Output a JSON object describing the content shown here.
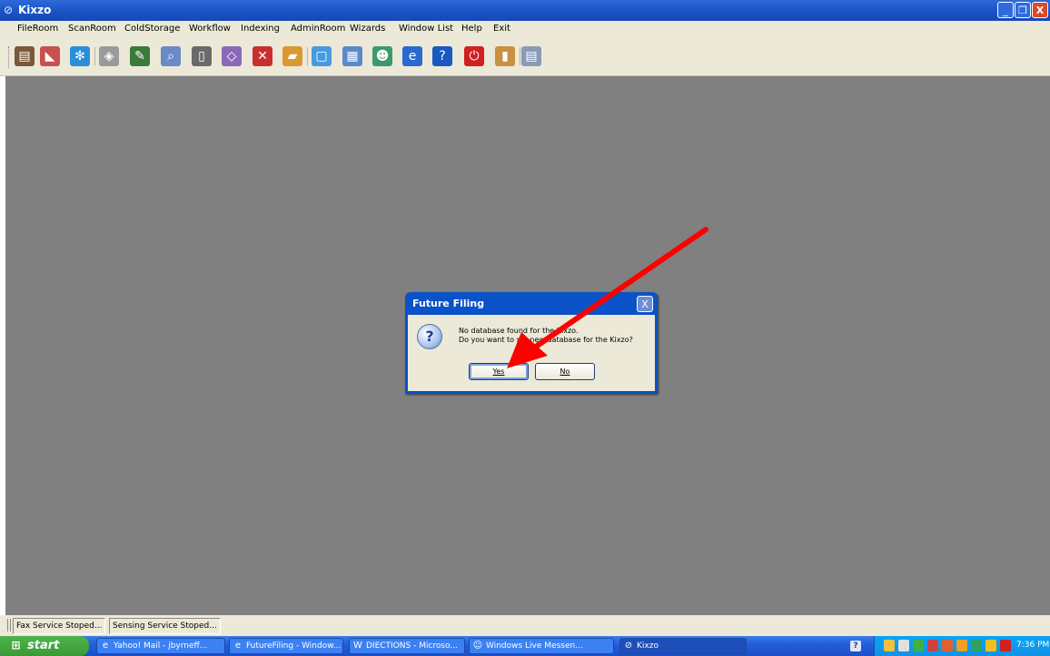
{
  "window": {
    "title": "Kixzo",
    "min": "_",
    "max": "❐",
    "close": "X"
  },
  "menu": {
    "items": [
      "FileRoom",
      "ScanRoom",
      "ColdStorage",
      "Workflow",
      "Indexing",
      "AdminRoom",
      "Wizards",
      "Window List",
      "Help",
      "Exit"
    ]
  },
  "toolbar": {
    "icons": [
      {
        "name": "fileroom-icon",
        "color": "#7a5a3a",
        "glyph": "▤"
      },
      {
        "name": "scanroom-icon",
        "color": "#c85050",
        "glyph": "◣"
      },
      {
        "name": "coldstorage-icon",
        "color": "#2a8ed8",
        "glyph": "✻"
      },
      {
        "name": "workflow-icon",
        "color": "#9a9a9a",
        "glyph": "◈"
      },
      {
        "name": "indexing-icon",
        "color": "#3a7a3a",
        "glyph": "✎"
      },
      {
        "name": "search-doc-icon",
        "color": "#6a8ac8",
        "glyph": "⌕"
      },
      {
        "name": "document-icon",
        "color": "#6a6a6a",
        "glyph": "▯"
      },
      {
        "name": "tag-icon",
        "color": "#8a6ab8",
        "glyph": "◇"
      },
      {
        "name": "delete-icon",
        "color": "#c83030",
        "glyph": "✕"
      },
      {
        "name": "folder-icon",
        "color": "#d89a30",
        "glyph": "▰"
      },
      {
        "name": "pages-icon",
        "color": "#4a9ae0",
        "glyph": "▢"
      },
      {
        "name": "calendar-icon",
        "color": "#5a8ac8",
        "glyph": "▦"
      },
      {
        "name": "users-icon",
        "color": "#3a9a6a",
        "glyph": "☻"
      },
      {
        "name": "internet-explorer-icon",
        "color": "#2a6ad0",
        "glyph": "e"
      },
      {
        "name": "help-icon",
        "color": "#1a5ac0",
        "glyph": "?"
      },
      {
        "name": "power-icon",
        "color": "#d02020",
        "glyph": "⏻"
      },
      {
        "name": "exit-door-icon",
        "color": "#c89040",
        "glyph": "▮"
      },
      {
        "name": "options-dropdown-icon",
        "color": "#8a9ab8",
        "glyph": "▤"
      }
    ]
  },
  "dialog": {
    "title": "Future Filing",
    "close": "X",
    "icon": "question-icon",
    "line1": "No database found for the Kixzo.",
    "line2": "Do you want to set new database for the Kixzo?",
    "yes": "Yes",
    "no": "No"
  },
  "annotation": {
    "color": "#ff0000"
  },
  "statusbar": {
    "panels": [
      "Fax Service Stoped...",
      "Sensing Service Stoped..."
    ]
  },
  "taskbar": {
    "start": "start",
    "tasks": [
      {
        "label": "Yahoo! Mail - jbyrneff...",
        "icon": "ie-icon"
      },
      {
        "label": "FutureFiling - Window...",
        "icon": "ie-icon"
      },
      {
        "label": "DIECTIONS - Microso...",
        "icon": "word-icon"
      },
      {
        "label": "Windows Live Messen...",
        "icon": "messenger-icon"
      },
      {
        "label": "Kixzo",
        "icon": "kixzo-icon"
      }
    ],
    "clock": "7:36 PM"
  }
}
